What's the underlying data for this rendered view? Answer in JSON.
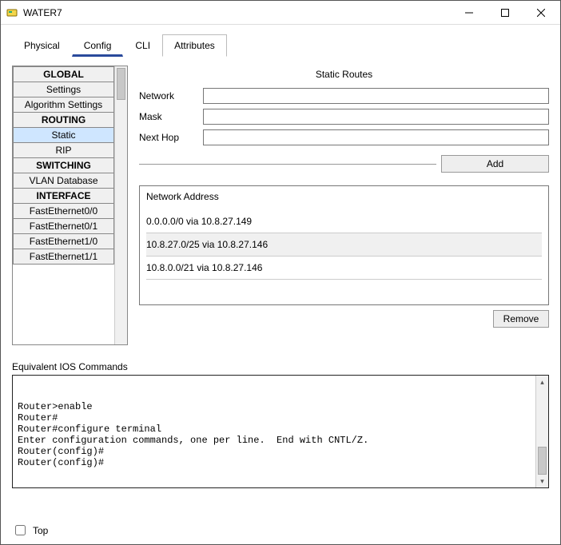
{
  "window": {
    "title": "WATER7"
  },
  "tabs": [
    "Physical",
    "Config",
    "CLI",
    "Attributes"
  ],
  "active_tab_index": 3,
  "underline_tab_index": 1,
  "sidebar": {
    "groups": [
      {
        "header": "GLOBAL",
        "items": [
          "Settings",
          "Algorithm Settings"
        ]
      },
      {
        "header": "ROUTING",
        "items": [
          "Static",
          "RIP"
        ]
      },
      {
        "header": "SWITCHING",
        "items": [
          "VLAN Database"
        ]
      },
      {
        "header": "INTERFACE",
        "items": [
          "FastEthernet0/0",
          "FastEthernet0/1",
          "FastEthernet1/0",
          "FastEthernet1/1"
        ]
      }
    ],
    "selected": "Static"
  },
  "panel": {
    "title": "Static Routes",
    "fields": {
      "network_label": "Network",
      "mask_label": "Mask",
      "nexthop_label": "Next Hop",
      "network_value": "",
      "mask_value": "",
      "nexthop_value": ""
    },
    "add_label": "Add",
    "routes_header": "Network Address",
    "routes": [
      "0.0.0.0/0 via 10.8.27.149",
      "10.8.27.0/25 via 10.8.27.146",
      "10.8.0.0/21 via 10.8.27.146"
    ],
    "selected_route_index": 1,
    "remove_label": "Remove"
  },
  "ios": {
    "label": "Equivalent IOS Commands",
    "lines": [
      "",
      "",
      "Router>enable",
      "Router#",
      "Router#configure terminal",
      "Enter configuration commands, one per line.  End with CNTL/Z.",
      "Router(config)#",
      "Router(config)#"
    ]
  },
  "footer": {
    "top_label": "Top",
    "top_checked": false
  }
}
